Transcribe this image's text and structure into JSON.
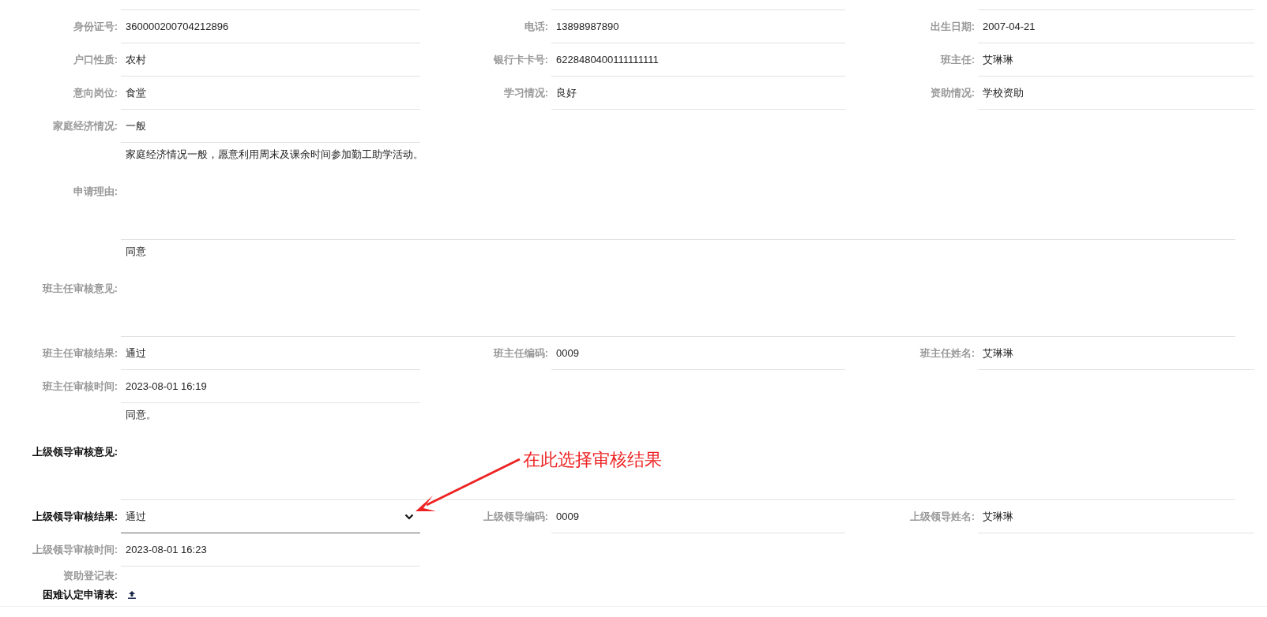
{
  "rows": [
    {
      "fields": [
        {
          "label": "身份证号:",
          "value": "360000200704212896",
          "kind": "text",
          "editable": false
        },
        {
          "label": "电话:",
          "value": "13898987890",
          "kind": "text",
          "editable": false
        },
        {
          "label": "出生日期:",
          "value": "2007-04-21",
          "kind": "text",
          "editable": false
        }
      ]
    },
    {
      "fields": [
        {
          "label": "户口性质:",
          "value": "农村",
          "kind": "text",
          "editable": false
        },
        {
          "label": "银行卡卡号:",
          "value": "6228480400111111111",
          "kind": "text",
          "editable": false
        },
        {
          "label": "班主任:",
          "value": "艾琳琳",
          "kind": "text",
          "editable": false
        }
      ]
    },
    {
      "fields": [
        {
          "label": "意向岗位:",
          "value": "食堂",
          "kind": "text",
          "editable": false
        },
        {
          "label": "学习情况:",
          "value": "良好",
          "kind": "text",
          "editable": false
        },
        {
          "label": "资助情况:",
          "value": "学校资助",
          "kind": "text",
          "editable": false
        }
      ]
    },
    {
      "fields": [
        {
          "label": "家庭经济情况:",
          "value": "一般",
          "kind": "text",
          "editable": false
        }
      ]
    },
    {
      "fields": [
        {
          "label": "申请理由:",
          "value": "家庭经济情况一般，愿意利用周末及课余时间参加勤工助学活动。",
          "kind": "textarea",
          "editable": false
        }
      ]
    },
    {
      "fields": [
        {
          "label": "班主任审核意见:",
          "value": "同意",
          "kind": "textarea",
          "editable": false
        }
      ]
    },
    {
      "fields": [
        {
          "label": "班主任审核结果:",
          "value": "通过",
          "kind": "text",
          "editable": false
        },
        {
          "label": "班主任编码:",
          "value": "0009",
          "kind": "text",
          "editable": false
        },
        {
          "label": "班主任姓名:",
          "value": "艾琳琳",
          "kind": "text",
          "editable": false
        }
      ]
    },
    {
      "fields": [
        {
          "label": "班主任审核时间:",
          "value": "2023-08-01 16:19",
          "kind": "text",
          "editable": false
        }
      ]
    },
    {
      "fields": [
        {
          "label": "上级领导审核意见:",
          "value": "同意。",
          "kind": "textarea",
          "editable": true
        }
      ]
    },
    {
      "fields": [
        {
          "label": "上级领导审核结果:",
          "value": "通过",
          "kind": "select",
          "editable": true
        },
        {
          "label": "上级领导编码:",
          "value": "0009",
          "kind": "text",
          "editable": false
        },
        {
          "label": "上级领导姓名:",
          "value": "艾琳琳",
          "kind": "text",
          "editable": false
        }
      ]
    },
    {
      "fields": [
        {
          "label": "上级领导审核时间:",
          "value": "2023-08-01 16:23",
          "kind": "text",
          "editable": false
        }
      ]
    },
    {
      "fields": [
        {
          "label": "资助登记表:",
          "kind": "file",
          "editable": false
        }
      ]
    },
    {
      "fields": [
        {
          "label": "困难认定申请表:",
          "kind": "upload",
          "editable": true
        }
      ]
    }
  ],
  "annotation": {
    "text": "在此选择审核结果"
  }
}
